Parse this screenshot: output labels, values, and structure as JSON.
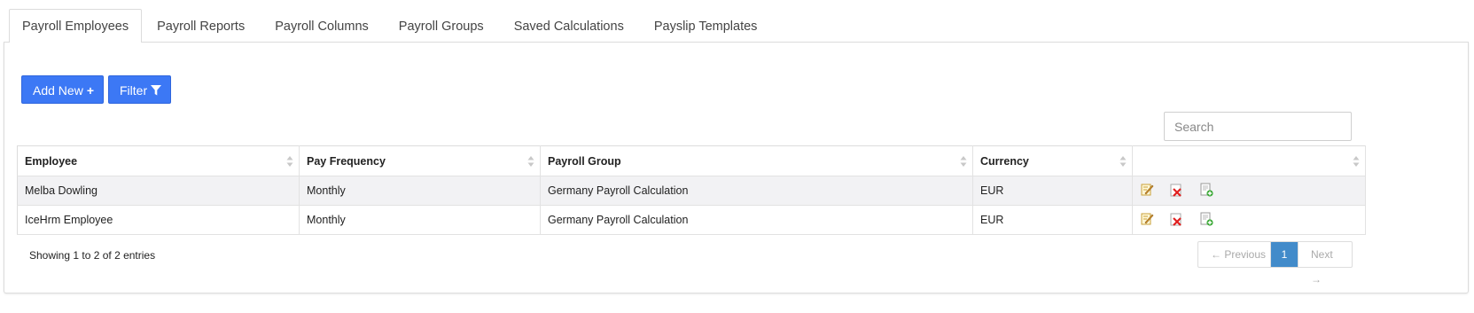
{
  "tabs": [
    {
      "label": "Payroll Employees",
      "active": true
    },
    {
      "label": "Payroll Reports"
    },
    {
      "label": "Payroll Columns"
    },
    {
      "label": "Payroll Groups"
    },
    {
      "label": "Saved Calculations"
    },
    {
      "label": "Payslip Templates"
    }
  ],
  "toolbar": {
    "add_label": "Add New",
    "filter_label": "Filter"
  },
  "search": {
    "placeholder": "Search",
    "value": ""
  },
  "table": {
    "headers": [
      "Employee",
      "Pay Frequency",
      "Payroll Group",
      "Currency",
      ""
    ],
    "rows": [
      [
        "Melba Dowling",
        "Monthly",
        "Germany Payroll Calculation",
        "EUR"
      ],
      [
        "IceHrm Employee",
        "Monthly",
        "Germany Payroll Calculation",
        "EUR"
      ]
    ],
    "row_actions": [
      "edit-icon",
      "delete-icon",
      "copy-icon"
    ]
  },
  "footer": {
    "info": "Showing 1 to 2 of 2 entries",
    "prev_label": "← Previous",
    "current_page": "1",
    "next_label": "Next →"
  },
  "colors": {
    "accent": "#3c78f5",
    "pager_active": "#428bca",
    "row_stripe": "#f2f2f4"
  }
}
